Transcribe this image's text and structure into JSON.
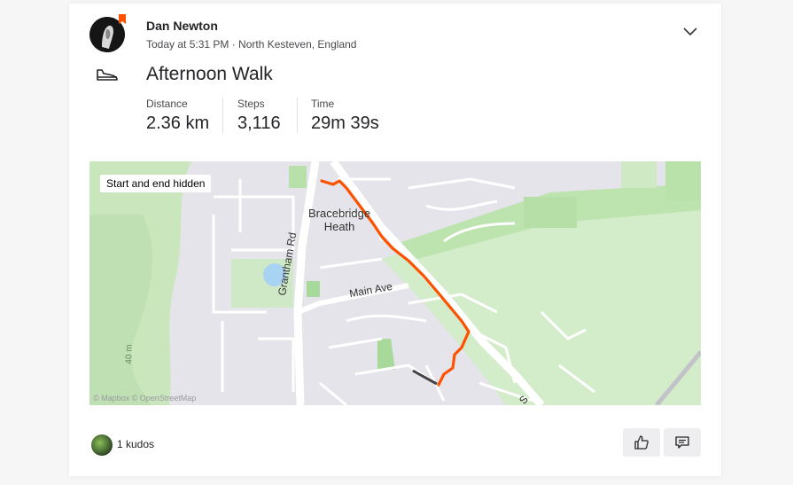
{
  "athlete": {
    "name": "Dan Newton",
    "meta": "Today at 5:31 PM · North Kesteven, England"
  },
  "activity": {
    "sport": "walk",
    "title": "Afternoon Walk",
    "stats": [
      {
        "label": "Distance",
        "value": "2.36 km"
      },
      {
        "label": "Steps",
        "value": "3,116"
      },
      {
        "label": "Time",
        "value": "29m 39s"
      }
    ]
  },
  "map": {
    "privacy_note": "Start and end hidden",
    "place_line1": "Bracebridge",
    "place_line2": "Heath",
    "road_grantham": "Grantham Rd",
    "road_main": "Main Ave",
    "road_s": "S",
    "contour": "40 m",
    "attribution": "© Mapbox © OpenStreetMap",
    "route_color": "#fc5200",
    "hidden_segment_color": "#444444"
  },
  "kudos": {
    "text": "1 kudos"
  },
  "icons": {
    "menu": "chevron-down-icon",
    "sport": "shoe-icon",
    "kudos": "thumbs-up-icon",
    "comment": "comment-icon"
  }
}
